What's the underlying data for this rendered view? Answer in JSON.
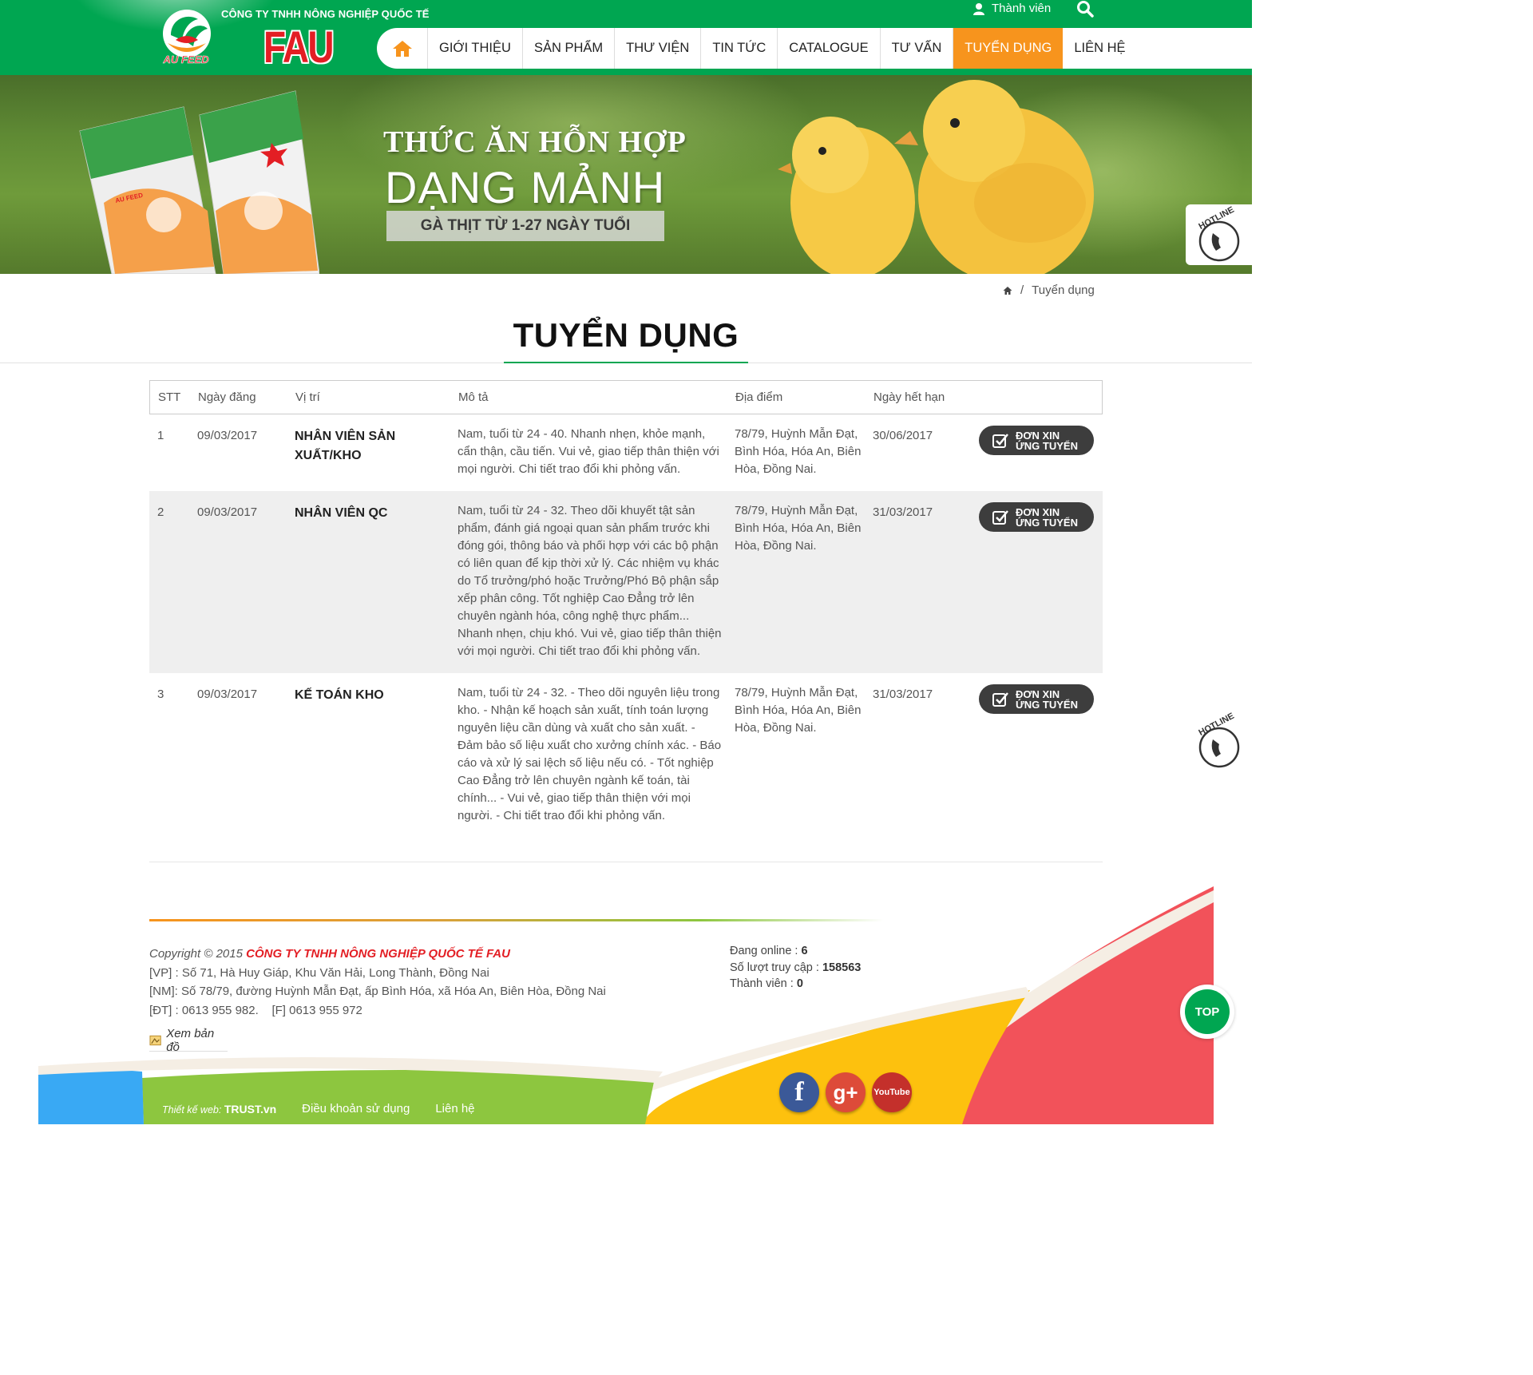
{
  "header": {
    "company_line": "CÔNG TY TNHH NÔNG NGHIỆP QUỐC TẾ",
    "brand": "FAU",
    "logo_text": "AU FEED",
    "member_label": "Thành viên",
    "nav": [
      "GIỚI THIỆU",
      "SẢN PHẨM",
      "THƯ VIỆN",
      "TIN TỨC",
      "CATALOGUE",
      "TƯ VẤN",
      "TUYỂN DỤNG",
      "LIÊN HỆ"
    ],
    "active_nav": "TUYỂN DỤNG",
    "colors": {
      "primary": "#00a651",
      "accent": "#f7941d",
      "brand_red": "#e31e24"
    }
  },
  "banner": {
    "line1": "THỨC ĂN HỖN HỢP",
    "line2": "DẠNG MẢNH",
    "line3": "GÀ THỊT TỪ 1-27 NGÀY TUỔI",
    "bag_text": "AU FEED"
  },
  "hotline_label": "HOTLINE",
  "breadcrumb": {
    "current": "Tuyển dụng"
  },
  "page_title": "TUYỂN DỤNG",
  "table": {
    "headers": {
      "stt": "STT",
      "date": "Ngày đăng",
      "position": "Vị trí",
      "description": "Mô tả",
      "location": "Địa điểm",
      "expiry": "Ngày hết hạn"
    },
    "apply_label_1": "ĐƠN XIN",
    "apply_label_2": "ỨNG TUYỂN",
    "rows": [
      {
        "stt": "1",
        "date": "09/03/2017",
        "position": "NHÂN VIÊN SẢN XUẤT/KHO",
        "description": "Nam, tuổi từ 24 - 40. Nhanh nhẹn, khỏe mạnh, cẩn thận, cầu tiến. Vui vẻ, giao tiếp thân thiện với mọi người. Chi tiết trao đổi khi phỏng vấn.",
        "location": "78/79, Huỳnh Mẫn Đạt, Bình Hóa, Hóa An, Biên Hòa, Đồng Nai.",
        "expiry": "30/06/2017"
      },
      {
        "stt": "2",
        "date": "09/03/2017",
        "position": "NHÂN VIÊN QC",
        "description": "Nam, tuổi từ 24 - 32. Theo dõi khuyết tật sản phẩm, đánh giá ngoại quan sản phẩm trước khi đóng gói, thông báo và phối hợp với các bộ phận có liên quan để kịp thời xử lý. Các nhiệm vụ khác do Tổ trưởng/phó hoặc Trưởng/Phó Bộ phận sắp xếp phân công. Tốt nghiệp Cao Đẳng trở lên chuyên ngành hóa, công nghệ thực phẩm... Nhanh nhẹn, chịu khó. Vui vẻ, giao tiếp thân thiện với mọi người. Chi tiết trao đổi khi phỏng vấn.",
        "location": "78/79, Huỳnh Mẫn Đạt, Bình Hóa, Hóa An, Biên Hòa, Đồng Nai.",
        "expiry": "31/03/2017"
      },
      {
        "stt": "3",
        "date": "09/03/2017",
        "position": "KẾ TOÁN KHO",
        "description": "Nam, tuổi từ 24 - 32. - Theo dõi nguyên liệu trong kho. - Nhận kế hoạch sản xuất, tính toán lượng nguyên liệu cần dùng và xuất cho sản xuất. - Đảm bảo số liệu xuất cho xưởng chính xác. - Báo cáo và xử lý sai lệch số liệu nếu có. - Tốt nghiệp Cao Đẳng trở lên chuyên ngành kế toán, tài chính... - Vui vẻ, giao tiếp thân thiện với mọi người. - Chi tiết trao đổi khi phỏng vấn.",
        "location": "78/79, Huỳnh Mẫn Đạt, Bình Hóa, Hóa An, Biên Hòa, Đồng Nai.",
        "expiry": "31/03/2017"
      }
    ]
  },
  "footer": {
    "copyright_prefix": "Copyright © 2015",
    "company": "CÔNG TY TNHH NÔNG NGHIỆP QUỐC TẾ FAU",
    "office": "[VP] : Số 71, Hà Huy Giáp, Khu Văn Hải, Long Thành, Đồng Nai",
    "factory": "[NM]: Số 78/79, đường Huỳnh Mẫn Đạt, ấp Bình Hóa, xã Hóa An, Biên Hòa, Đồng Nai",
    "phone": "[ĐT] : 0613 955 982.",
    "fax": "[F] 0613 955 972",
    "map_link": "Xem bản đồ",
    "online_label": "Đang online :",
    "online": "6",
    "visits_label": "Số lượt truy cập :",
    "visits": "158563",
    "members_label": "Thành viên :",
    "members": "0",
    "credit_prefix": "Thiết kế web:",
    "credit_brand": "TRUST.vn",
    "terms": "Điều khoản sử dụng",
    "contact": "Liên hệ",
    "social": {
      "facebook": "f",
      "google": "g+",
      "youtube": "YouTube"
    },
    "top_label": "TOP"
  }
}
